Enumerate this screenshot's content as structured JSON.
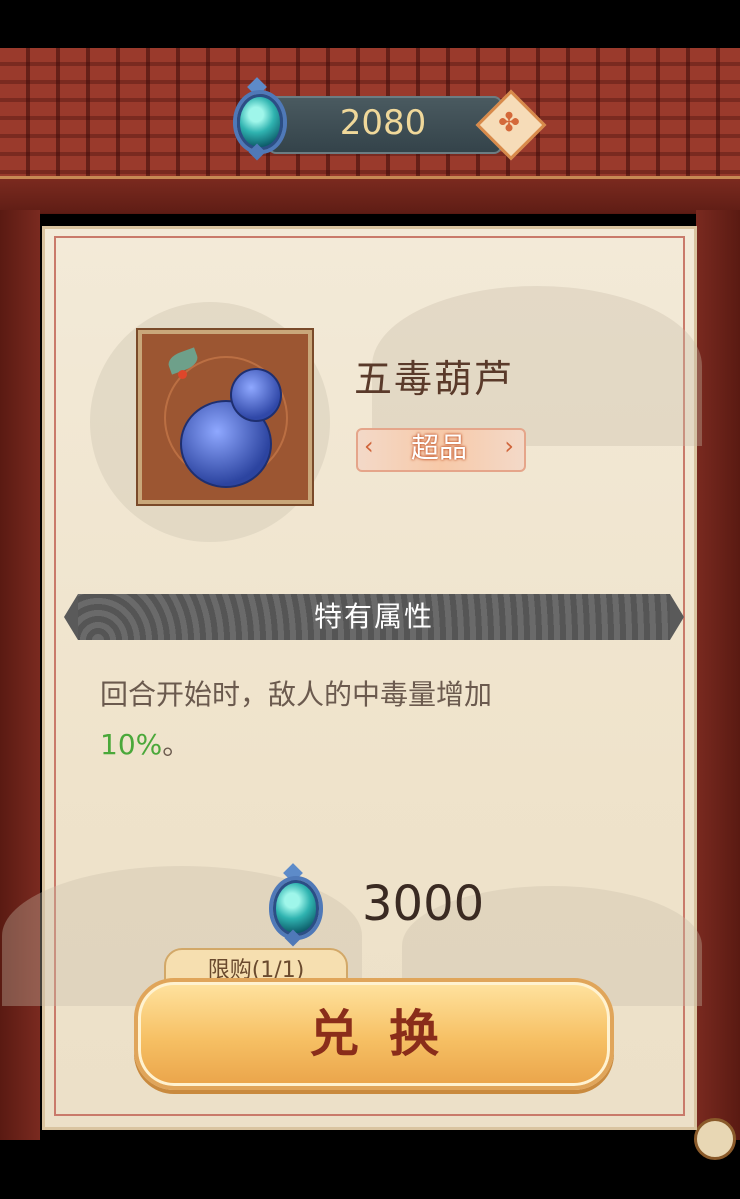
{
  "currency": {
    "amount": "2080",
    "gem_icon": "jade-gem-icon",
    "add_icon": "add-currency-icon"
  },
  "item": {
    "name": "五毒葫芦",
    "grade": "超品",
    "icon": "gourd-icon"
  },
  "attributes": {
    "title": "特有属性",
    "description_prefix": "回合开始时，敌人的中毒量增加",
    "description_value": "10%",
    "description_suffix": "。"
  },
  "purchase": {
    "price": "3000",
    "limit_label": "限购(1/1)",
    "exchange_label": "兑换"
  },
  "colors": {
    "accent_green": "#4aa83a",
    "button_gold": "#f6c064",
    "roof_red": "#9a3a2c"
  }
}
